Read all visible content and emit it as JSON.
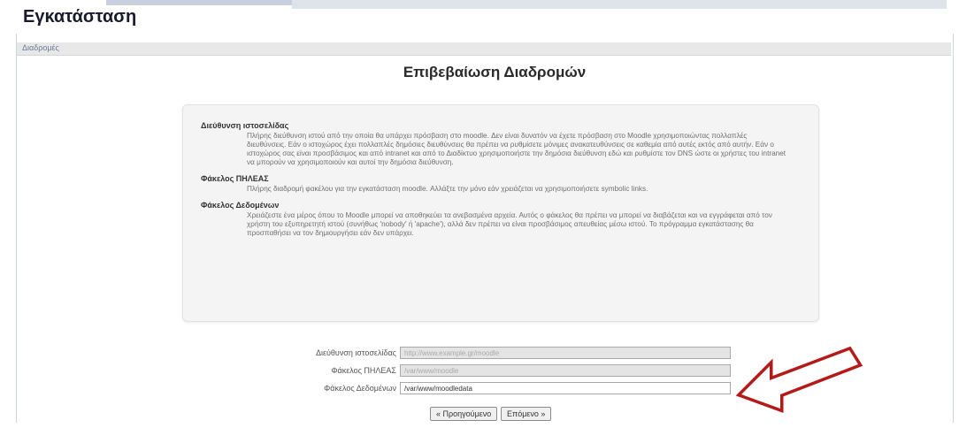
{
  "page": {
    "title": "Εγκατάσταση",
    "breadcrumb": "Διαδρομές",
    "section_title": "Επιβεβαίωση Διαδρομών"
  },
  "help": {
    "items": [
      {
        "term": "Διεύθυνση ιστοσελίδας",
        "description": "Πλήρης διεύθυνση ιστού από την οποία θα υπάρχει πρόσβαση στο moodle. Δεν είναι δυνατόν να έχετε πρόσβαση στο Moodle χρησιμοποιώντας πολλαπλές διευθύνσεις. Εάν ο ιστοχώρος έχει πολλαπλές δημόσιες διευθύνσεις θα πρέπει να ρυθμίσετε μόνιμες ανακατευθύνσεις σε καθεμία από αυτές εκτός από αυτήν. Εάν ο ιστοχώρος σας είναι προσβάσιμος και από intranet και από το Διαδίκτυο χρησιμοποιήστε την δημόσια διεύθυνση εδώ και ρυθμίστε τον DNS ώστε οι χρήστες του intranet να μπορούν να χρησιμοποιούν και αυτοί την δημόσια διεύθυνση."
      },
      {
        "term": "Φάκελος ΠΗΛΕΑΣ",
        "description": "Πλήρης διαδρομή φακέλου για την εγκατάσταση moodle. Αλλάξτε την μόνο εάν χρειάζεται να χρησιμοποιήσετε symbolic links."
      },
      {
        "term": "Φάκελος Δεδομένων",
        "description": "Χρειάζεστε ένα μέρος όπου το Moodle μπορεί να αποθηκεύει τα ανεβασμένα αρχεία. Αυτός ο φάκελος θα πρέπει να μπορεί να διαβάζεται και να εγγράφεται από τον χρήστη του εξυπηρετητή ιστού (συνήθως 'nobody' ή 'apache'), αλλά δεν πρέπει να είναι προσβάσιμος απευθείας μέσω ιστού. Το πρόγραμμα εγκατάστασης θα προσπαθήσει να τον δημιουργήσει εάν δεν υπάρχει."
      }
    ]
  },
  "form": {
    "wwwroot_label": "Διεύθυνση ιστοσελίδας",
    "wwwroot_value": "http://www.example.gr/moodle",
    "dirroot_label": "Φάκελος ΠΗΛΕΑΣ",
    "dirroot_value": "/var/www/moodle",
    "dataroot_label": "Φάκελος Δεδομένων",
    "dataroot_value": "/var/www/moodledata"
  },
  "buttons": {
    "previous": "« Προηγούμενο",
    "next": "Επόμενο »"
  },
  "colors": {
    "arrow_outline": "#b31b1b",
    "breadcrumb_bar": "#e8e8e8",
    "help_box": "#f4f4f4"
  }
}
